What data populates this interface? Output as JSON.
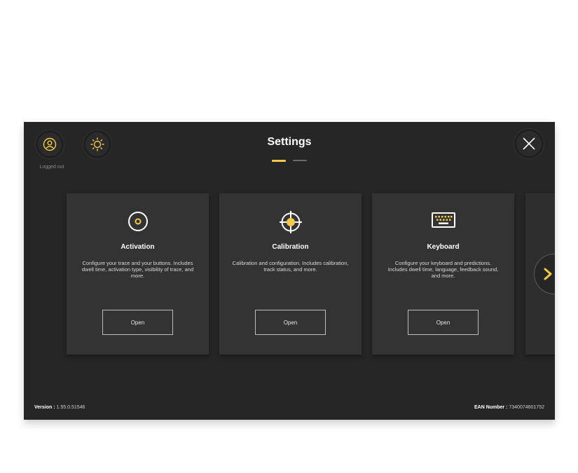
{
  "header": {
    "title": "Settings",
    "logged_status": "Logged out",
    "user_icon": "user-icon",
    "brightness_icon": "brightness-icon",
    "close_icon": "close-icon"
  },
  "pager": {
    "pages": 2,
    "active": 1
  },
  "cards": [
    {
      "title": "Activation",
      "description": "Configure your trace and your buttons. Includes dwell time, activation type, visibility of trace, and more.",
      "button": "Open",
      "icon": "activation-icon"
    },
    {
      "title": "Calibration",
      "description": "Calibration and configuration. Includes calibration, track status, and more.",
      "button": "Open",
      "icon": "calibration-target-icon"
    },
    {
      "title": "Keyboard",
      "description": "Configure your keyboard and predictions. Includes dwell time, language, feedback sound, and more.",
      "button": "Open",
      "icon": "keyboard-icon"
    }
  ],
  "next_icon": "chevron-right-icon",
  "footer": {
    "version_label": "Version :",
    "version_value": "1.55.0.51546",
    "ean_label": "EAN Number :",
    "ean_value": "7340074601752"
  },
  "colors": {
    "accent": "#f2c94c",
    "background": "#262626",
    "card": "#333333"
  }
}
